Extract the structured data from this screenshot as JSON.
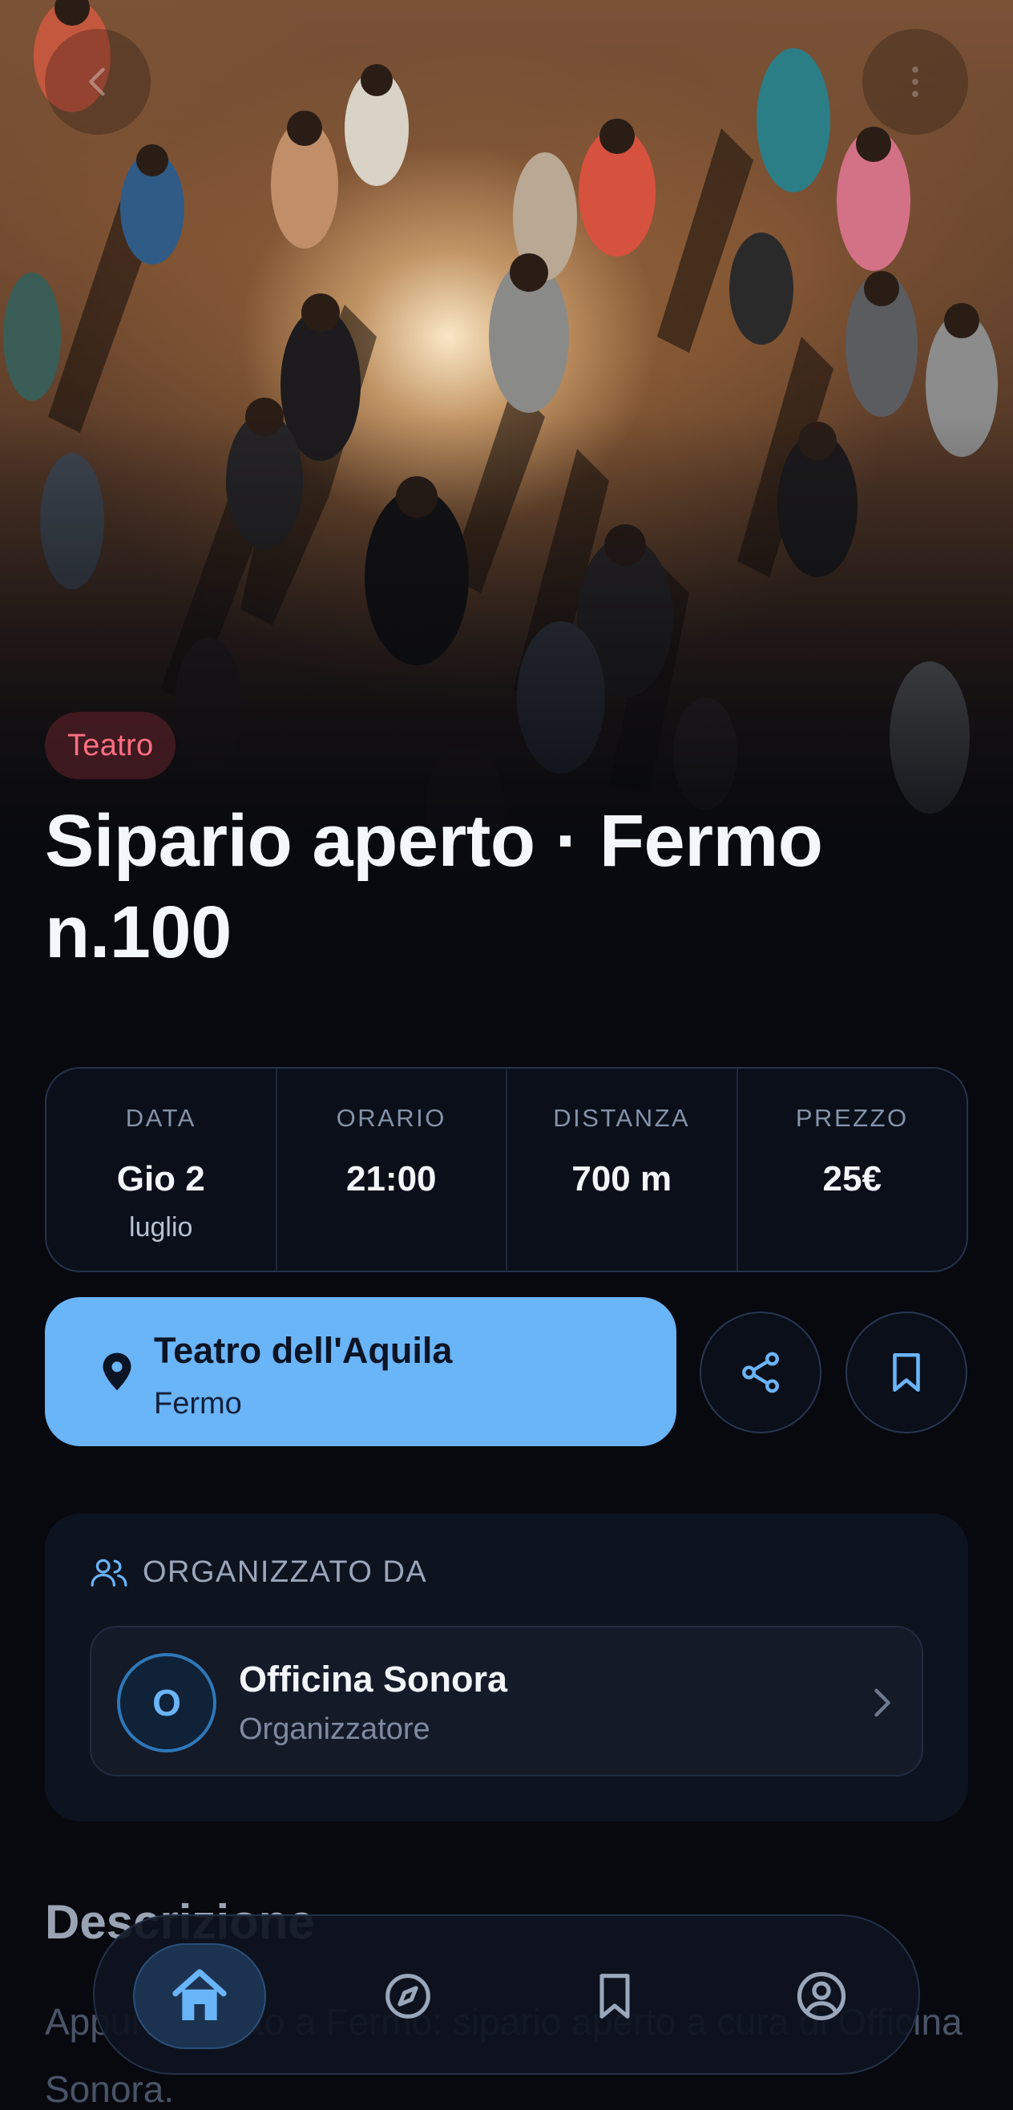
{
  "hero": {
    "category": "Teatro",
    "title": "Sipario aperto · Fermo n.100",
    "back_icon": "arrow-left-icon",
    "more_icon": "more-vertical-icon"
  },
  "details": [
    {
      "label": "DATA",
      "value": "Gio 2",
      "sub": "luglio"
    },
    {
      "label": "ORARIO",
      "value": "21:00",
      "sub": ""
    },
    {
      "label": "DISTANZA",
      "value": "700 m",
      "sub": ""
    },
    {
      "label": "PREZZO",
      "value": "25€",
      "sub": ""
    }
  ],
  "venue": {
    "name": "Teatro dell'Aquila",
    "city": "Fermo",
    "icon": "map-pin-icon"
  },
  "actions": {
    "share_icon": "share-icon",
    "save_icon": "bookmark-icon"
  },
  "organizer": {
    "section_label": "ORGANIZZATO DA",
    "initial": "O",
    "name": "Officina Sonora",
    "role": "Organizzatore"
  },
  "description": {
    "title": "Descrizione",
    "text": "Appuntamento a Fermo: sipario aperto a cura di Officina Sonora."
  },
  "nav": {
    "items": [
      "home-icon",
      "compass-icon",
      "bookmark-icon",
      "profile-icon"
    ],
    "active": "home-icon"
  },
  "colors": {
    "accent": "#6ab4f8",
    "background": "#07090f",
    "category": "#ff6f82"
  }
}
